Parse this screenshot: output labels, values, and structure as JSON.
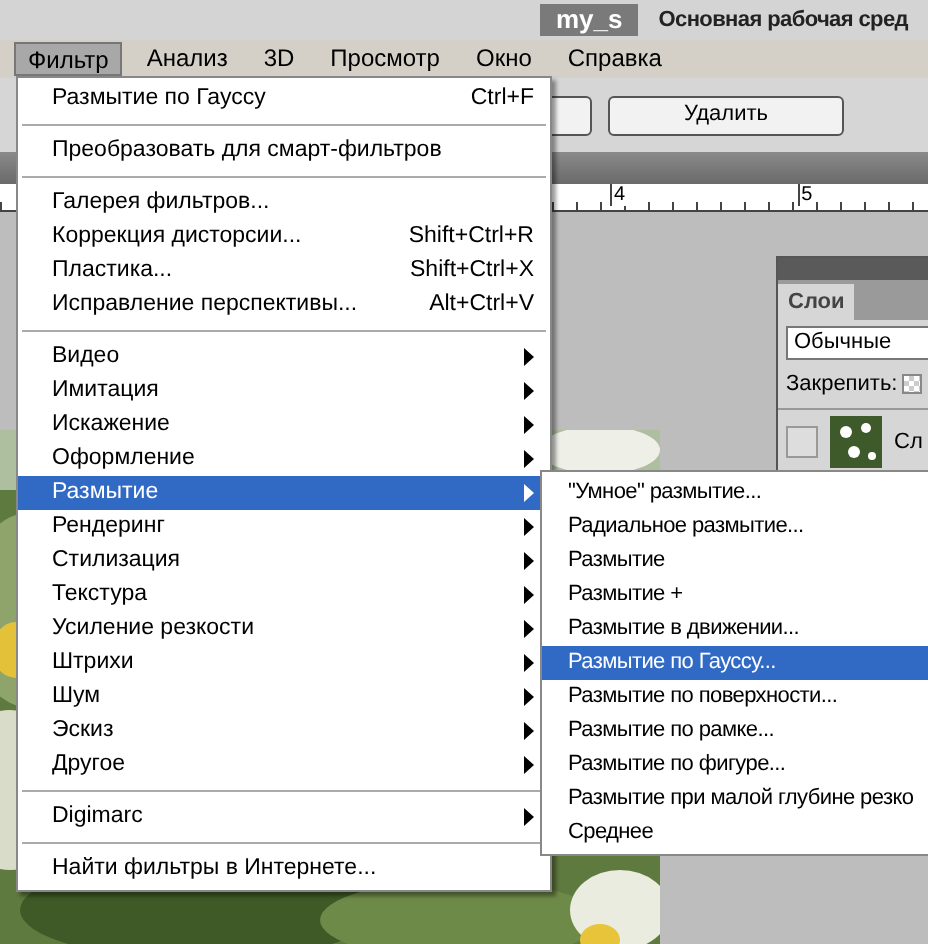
{
  "app_bar": {
    "badge": "my_s",
    "workspace": "Основная рабочая сред"
  },
  "menu_bar": [
    {
      "label": "Фильтр",
      "selected": true
    },
    {
      "label": "Анализ",
      "selected": false
    },
    {
      "label": "3D",
      "selected": false
    },
    {
      "label": "Просмотр",
      "selected": false
    },
    {
      "label": "Окно",
      "selected": false
    },
    {
      "label": "Справка",
      "selected": false
    }
  ],
  "options_bar": {
    "button": "Удалить"
  },
  "ruler": [
    "4",
    "5"
  ],
  "layers_panel": {
    "tab": "Слои",
    "blend_mode": "Обычные",
    "lock_label": "Закрепить:",
    "layer_name": "Сл"
  },
  "filter_menu": [
    {
      "kind": "item",
      "label": "Размытие по Гауссу",
      "shortcut": "Ctrl+F",
      "selected": false
    },
    {
      "kind": "separator"
    },
    {
      "kind": "item",
      "label": "Преобразовать для смарт-фильтров",
      "selected": false
    },
    {
      "kind": "separator"
    },
    {
      "kind": "item",
      "label": "Галерея фильтров...",
      "selected": false
    },
    {
      "kind": "item",
      "label": "Коррекция дисторсии...",
      "shortcut": "Shift+Ctrl+R",
      "selected": false
    },
    {
      "kind": "item",
      "label": "Пластика...",
      "shortcut": "Shift+Ctrl+X",
      "selected": false
    },
    {
      "kind": "item",
      "label": "Исправление перспективы...",
      "shortcut": "Alt+Ctrl+V",
      "selected": false
    },
    {
      "kind": "separator"
    },
    {
      "kind": "submenu",
      "label": "Видео",
      "selected": false
    },
    {
      "kind": "submenu",
      "label": "Имитация",
      "selected": false
    },
    {
      "kind": "submenu",
      "label": "Искажение",
      "selected": false
    },
    {
      "kind": "submenu",
      "label": "Оформление",
      "selected": false
    },
    {
      "kind": "submenu",
      "label": "Размытие",
      "selected": true
    },
    {
      "kind": "submenu",
      "label": "Рендеринг",
      "selected": false
    },
    {
      "kind": "submenu",
      "label": "Стилизация",
      "selected": false
    },
    {
      "kind": "submenu",
      "label": "Текстура",
      "selected": false
    },
    {
      "kind": "submenu",
      "label": "Усиление резкости",
      "selected": false
    },
    {
      "kind": "submenu",
      "label": "Штрихи",
      "selected": false
    },
    {
      "kind": "submenu",
      "label": "Шум",
      "selected": false
    },
    {
      "kind": "submenu",
      "label": "Эскиз",
      "selected": false
    },
    {
      "kind": "submenu",
      "label": "Другое",
      "selected": false
    },
    {
      "kind": "separator"
    },
    {
      "kind": "submenu",
      "label": "Digimarc",
      "selected": false
    },
    {
      "kind": "separator"
    },
    {
      "kind": "item",
      "label": "Найти фильтры в Интернете...",
      "selected": false
    }
  ],
  "blur_submenu": [
    {
      "label": "\"Умное\" размытие...",
      "selected": false
    },
    {
      "label": "Радиальное размытие...",
      "selected": false
    },
    {
      "label": "Размытие",
      "selected": false
    },
    {
      "label": "Размытие +",
      "selected": false
    },
    {
      "label": "Размытие в движении...",
      "selected": false
    },
    {
      "label": "Размытие по Гауссу...",
      "selected": true
    },
    {
      "label": "Размытие по поверхности...",
      "selected": false
    },
    {
      "label": "Размытие по рамке...",
      "selected": false
    },
    {
      "label": "Размытие по фигуре...",
      "selected": false
    },
    {
      "label": "Размытие при малой глубине резко",
      "selected": false
    },
    {
      "label": "Среднее",
      "selected": false
    }
  ]
}
